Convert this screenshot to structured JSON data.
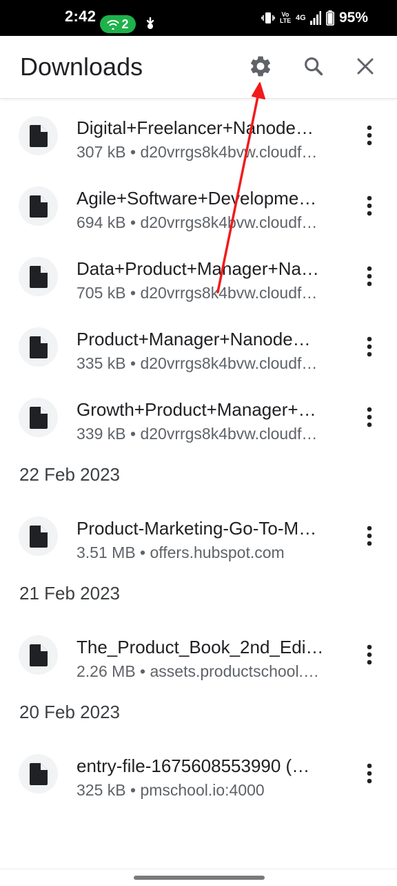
{
  "status_bar": {
    "time": "2:42",
    "hotspot_count": "2",
    "network_label": "Vo LTE",
    "signal_label": "4G",
    "battery": "95%"
  },
  "app_bar": {
    "title": "Downloads",
    "icons": [
      "gear-icon",
      "search-icon",
      "close-icon"
    ]
  },
  "groups": [
    {
      "date": "",
      "items": [
        {
          "name": "Digital+Freelancer+Nanodegree+Syllabus.pdf",
          "display_name": "Digital+Freelancer+Nanode…",
          "meta": "307 kB • d20vrrgs8k4bvw.cloudf…"
        },
        {
          "name": "Agile+Software+Developme…",
          "display_name": "Agile+Software+Developme…",
          "meta": "694 kB • d20vrrgs8k4bvw.cloudf…"
        },
        {
          "name": "Data+Product+Manager+Na…",
          "display_name": "Data+Product+Manager+Na…",
          "meta": "705 kB • d20vrrgs8k4bvw.cloudf…"
        },
        {
          "name": "Product+Manager+Nanode…",
          "display_name": "Product+Manager+Nanode…",
          "meta": "335 kB • d20vrrgs8k4bvw.cloudf…"
        },
        {
          "name": "Growth+Product+Manager+…",
          "display_name": "Growth+Product+Manager+…",
          "meta": "339 kB • d20vrrgs8k4bvw.cloudf…"
        }
      ]
    },
    {
      "date": "22 Feb 2023",
      "items": [
        {
          "name": "Product-Marketing-Go-To-M…",
          "display_name": "Product-Marketing-Go-To-M…",
          "meta": "3.51 MB • offers.hubspot.com"
        }
      ]
    },
    {
      "date": "21 Feb 2023",
      "items": [
        {
          "name": "The_Product_Book_2nd_Edi…",
          "display_name": "The_Product_Book_2nd_Edi…",
          "meta": "2.26 MB • assets.productschool.…"
        }
      ]
    },
    {
      "date": "20 Feb 2023",
      "items": [
        {
          "name": "entry-file-1675608553990 (…",
          "display_name": "entry-file-1675608553990 (…",
          "meta": "325 kB • pmschool.io:4000"
        }
      ]
    }
  ],
  "colors": {
    "annotation_arrow": "#f21b1b",
    "hotspot_pill": "#1fb14b",
    "text_primary": "#202124",
    "text_secondary": "#5f6368"
  }
}
